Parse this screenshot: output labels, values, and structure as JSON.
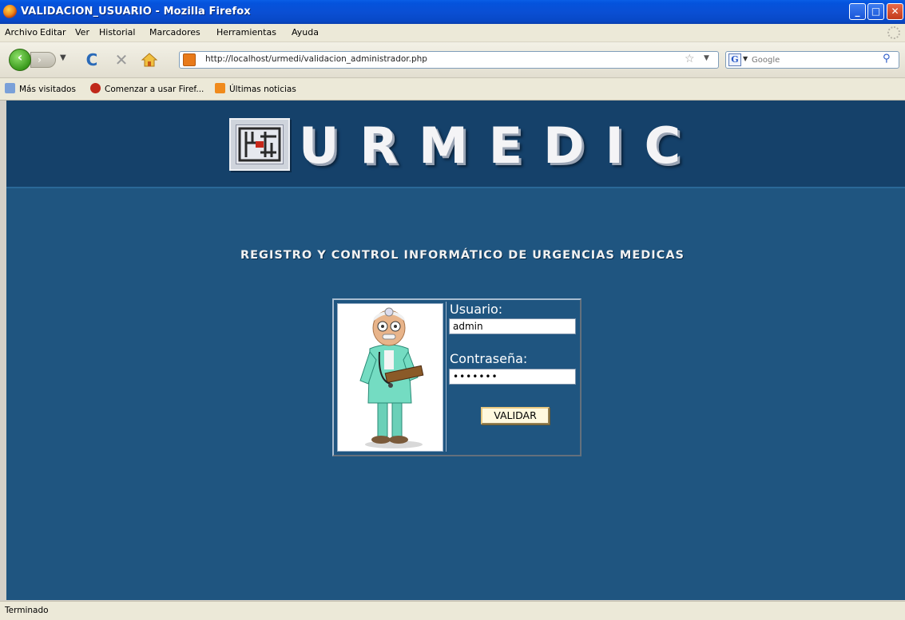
{
  "window": {
    "title": "VALIDACION_USUARIO - Mozilla Firefox",
    "controls": {
      "minimize": "_",
      "maximize": "□",
      "close": "✕"
    }
  },
  "menubar": {
    "items": [
      "Archivo",
      "Editar",
      "Ver",
      "Historial",
      "Marcadores",
      "Herramientas",
      "Ayuda"
    ]
  },
  "navbar": {
    "back_icon": "back-arrow-icon",
    "forward_icon": "forward-arrow-icon",
    "reload_glyph": "C",
    "stop_glyph": "✕",
    "url": "http://localhost/urmedi/validacion_administrador.php",
    "search_placeholder": "Google"
  },
  "bookmarks": {
    "items": [
      "Más visitados",
      "Comenzar a usar Firef...",
      "Últimas noticias"
    ]
  },
  "page": {
    "brand": "URMEDIC",
    "subtitle": "REGISTRO Y CONTROL INFORMÁTICO DE URGENCIAS MEDICAS",
    "login": {
      "user_label": "Usuario:",
      "user_value": "admin",
      "password_label": "Contraseña:",
      "password_value": "•••••••",
      "submit_label": "VALIDAR"
    },
    "colors": {
      "background": "#1f5580",
      "header": "#15416a"
    }
  },
  "status": {
    "text": "Terminado"
  }
}
